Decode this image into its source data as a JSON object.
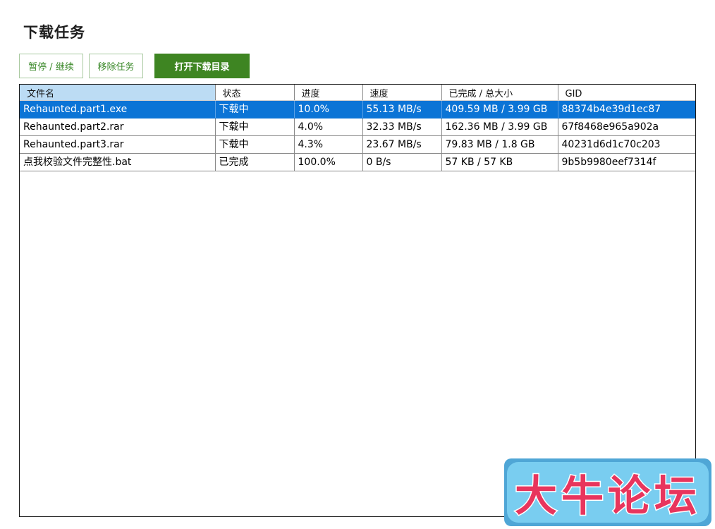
{
  "page": {
    "title": "下载任务"
  },
  "toolbar": {
    "pause_label": "暂停 / 继续",
    "remove_label": "移除任务",
    "open_dir_label": "打开下载目录"
  },
  "table": {
    "columns": [
      "文件名",
      "状态",
      "进度",
      "速度",
      "已完成 / 总大小",
      "GID"
    ],
    "rows": [
      {
        "name": "Rehaunted.part1.exe",
        "status": "下载中",
        "progress": "10.0%",
        "speed": "55.13 MB/s",
        "size": "409.59 MB / 3.99 GB",
        "gid": "88374b4e39d1ec87",
        "selected": true
      },
      {
        "name": "Rehaunted.part2.rar",
        "status": "下载中",
        "progress": "4.0%",
        "speed": "32.33 MB/s",
        "size": "162.36 MB / 3.99 GB",
        "gid": "67f8468e965a902a",
        "selected": false
      },
      {
        "name": "Rehaunted.part3.rar",
        "status": "下载中",
        "progress": "4.3%",
        "speed": "23.67 MB/s",
        "size": "79.83 MB / 1.8 GB",
        "gid": "40231d6d1c70c203",
        "selected": false
      },
      {
        "name": "点我校验文件完整性.bat",
        "status": "已完成",
        "progress": "100.0%",
        "speed": "0 B/s",
        "size": "57 KB / 57 KB",
        "gid": "9b5b9980eef7314f",
        "selected": false
      }
    ]
  },
  "watermark": {
    "text": "大牛论坛"
  },
  "colors": {
    "accent_green": "#3e8522",
    "selection_blue": "#0b74d6",
    "header_sorted": "#bcdcf4"
  }
}
